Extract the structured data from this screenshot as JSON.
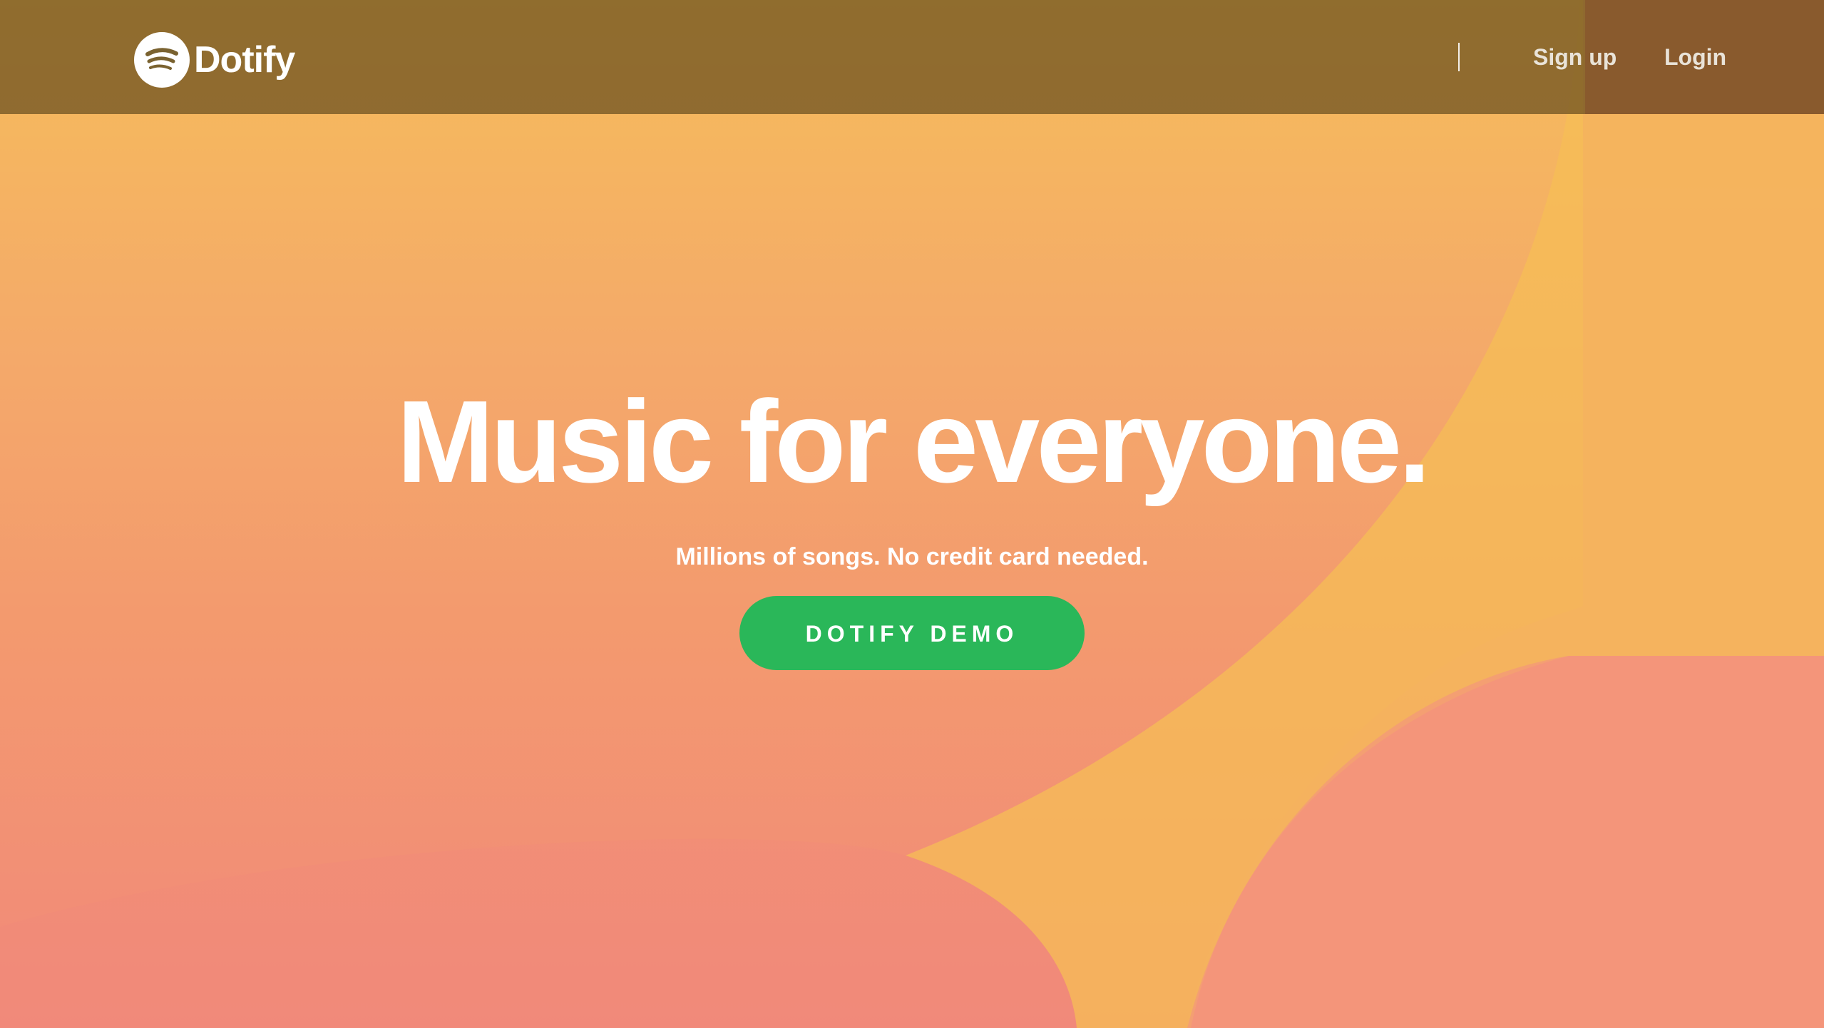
{
  "colors": {
    "accent_green": "#2ab759",
    "background_top": "#f6bd5a",
    "background_bottom": "#f2897a",
    "shape_yellow": "#f6bd55",
    "shape_coral": "#f38c73",
    "header_overlay": "#7a6230"
  },
  "header": {
    "brand": "Dotify",
    "logo_icon": "dotify-logo-icon",
    "nav": {
      "signup_label": "Sign up",
      "login_label": "Login"
    }
  },
  "hero": {
    "headline": "Music for everyone.",
    "subline": "Millions of songs. No credit card needed.",
    "cta_label": "DOTIFY DEMO"
  }
}
